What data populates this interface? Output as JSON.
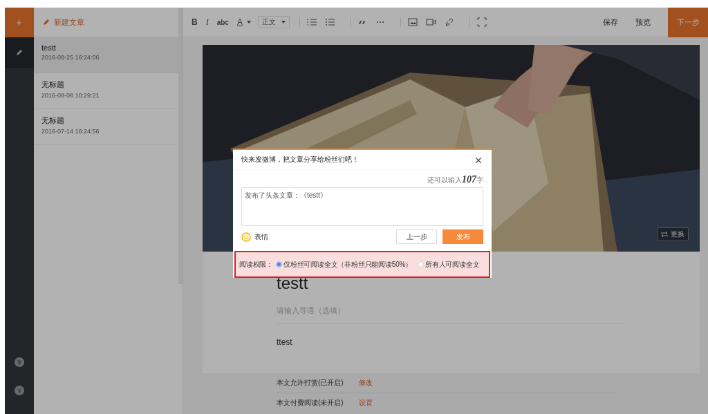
{
  "sidebar": {
    "new_button": "新建文章",
    "articles": [
      {
        "title": "testt",
        "date": "2016-08-25 16:24:06",
        "selected": true
      },
      {
        "title": "无标题",
        "date": "2016-08-08 10:29:21",
        "selected": false
      },
      {
        "title": "无标题",
        "date": "2016-07-14 16:24:56",
        "selected": false
      }
    ]
  },
  "toolbar": {
    "format_buttons": [
      "B",
      "I",
      "abc",
      "A"
    ],
    "style_select": "正文",
    "save": "保存",
    "preview": "预览",
    "next": "下一步"
  },
  "editor": {
    "change_cover": "更换",
    "title": "testt",
    "summary_placeholder": "请输入导语（选填）",
    "body": "ttest",
    "settings": [
      {
        "label": "本文允许打赏(已开启)",
        "action": "修改"
      },
      {
        "label": "本文付费阅读(未开启)",
        "action": "设置"
      }
    ]
  },
  "dialog": {
    "title": "快来发微博，把文章分享给粉丝们吧！",
    "counter": "还可以输入**107**字",
    "message": "发布了头条文章：《testt》",
    "emoji": "表情",
    "back": "上一步",
    "publish": "发布",
    "permission_label": "阅读权限：",
    "permissions": [
      {
        "label": "仅粉丝可阅读全文（非粉丝只能阅读50%）",
        "selected": true
      },
      {
        "label": "所有人可阅读全文",
        "selected": false
      }
    ]
  }
}
